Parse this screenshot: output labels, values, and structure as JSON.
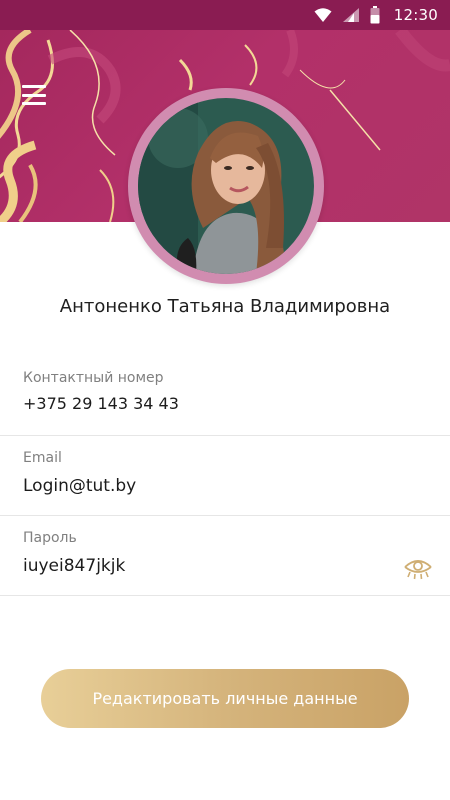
{
  "status_bar": {
    "time": "12:30",
    "icons": [
      "wifi-icon",
      "signal-icon",
      "battery-icon"
    ]
  },
  "header": {
    "menu_icon": "hamburger-menu-icon",
    "colors": {
      "background": "#a4285d",
      "swirl_gold": "#f0cf8a",
      "status_bar": "#8a1c52"
    }
  },
  "profile": {
    "name": "Антоненко Татьяна Владимировна",
    "avatar_ring_color": "#d18cb0"
  },
  "fields": {
    "phone": {
      "label": "Контактный номер",
      "value": "+375 29 143 34 43"
    },
    "email": {
      "label": "Email",
      "value": "Login@tut.by"
    },
    "password": {
      "label": "Пароль",
      "value": "iuyei847jkjk",
      "toggle_icon": "eye-icon"
    }
  },
  "actions": {
    "edit_label": "Редактировать личные данные",
    "accent_gold": "#d5b47c"
  }
}
